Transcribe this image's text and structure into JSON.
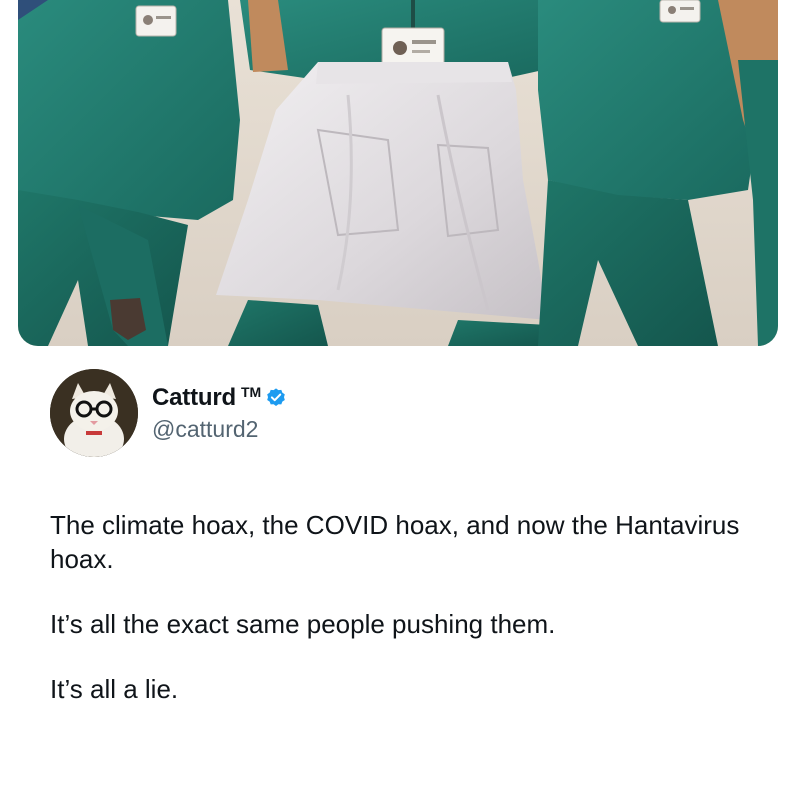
{
  "media": {
    "description_icon": "photo-media"
  },
  "author": {
    "display_name": "Catturd",
    "trademark": "TM",
    "handle": "@catturd2",
    "verified_icon": "verified-badge-icon",
    "verified_color": "#1d9bf0"
  },
  "tweet": {
    "line1": "The climate hoax, the COVID hoax, and now the Hantavirus hoax.",
    "line2": "It’s all the exact same people pushing them.",
    "line3": "It’s all a lie."
  },
  "colors": {
    "scrubs": "#1f7a6e",
    "text_primary": "#0f1419",
    "text_secondary": "#536471"
  }
}
